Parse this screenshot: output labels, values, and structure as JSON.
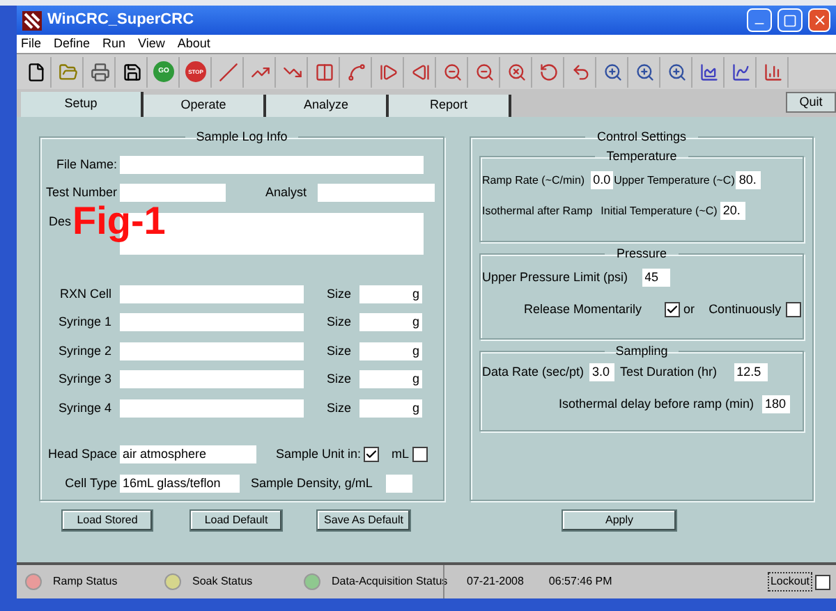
{
  "window": {
    "title": "WinCRC_SuperCRC"
  },
  "menu": [
    "File",
    "Define",
    "Run",
    "View",
    "About"
  ],
  "toolbar": {
    "go": "GO",
    "stop": "STOP"
  },
  "tabs": [
    {
      "label": "Setup",
      "selected": true
    },
    {
      "label": "Operate",
      "selected": false
    },
    {
      "label": "Analyze",
      "selected": false
    },
    {
      "label": "Report",
      "selected": false
    }
  ],
  "quit": "Quit",
  "overlay": "Fig-1",
  "sample_log": {
    "title": "Sample Log Info",
    "file_name": {
      "label": "File Name:"
    },
    "test_number": {
      "label": "Test Number"
    },
    "analyst": {
      "label": "Analyst"
    },
    "description": {
      "label": "Des"
    },
    "components": [
      {
        "label": "RXN Cell",
        "size_label": "Size",
        "unit": "g"
      },
      {
        "label": "Syringe 1",
        "size_label": "Size",
        "unit": "g"
      },
      {
        "label": "Syringe 2",
        "size_label": "Size",
        "unit": "g"
      },
      {
        "label": "Syringe 3",
        "size_label": "Size",
        "unit": "g"
      },
      {
        "label": "Syringe 4",
        "size_label": "Size",
        "unit": "g"
      }
    ],
    "head_space": {
      "label": "Head Space",
      "value": "air atmosphere"
    },
    "sample_unit": {
      "label": "Sample Unit in:",
      "checked": true
    },
    "ml": {
      "label": "mL",
      "checked": false
    },
    "cell_type": {
      "label": "Cell Type",
      "value": "16mL glass/teflon"
    },
    "density": {
      "label": "Sample Density, g/mL"
    }
  },
  "control": {
    "title": "Control Settings",
    "temperature": {
      "title": "Temperature",
      "ramp_rate": {
        "label": "Ramp Rate (~C/min)",
        "value": "0.0"
      },
      "upper": {
        "label": "Upper Temperature (~C)",
        "value": "80."
      },
      "isothermal": "Isothermal after Ramp",
      "initial": {
        "label": "Initial Temperature (~C)",
        "value": "20."
      }
    },
    "pressure": {
      "title": "Pressure",
      "limit": {
        "label": "Upper Pressure Limit (psi)",
        "value": "45"
      },
      "momentarily": {
        "label": "Release Momentarily",
        "checked": true
      },
      "or": "or",
      "continuously": {
        "label": "Continuously",
        "checked": false
      }
    },
    "sampling": {
      "title": "Sampling",
      "data_rate": {
        "label": "Data Rate (sec/pt)",
        "value": "3.0"
      },
      "duration": {
        "label": "Test Duration (hr)",
        "value": "12.5"
      },
      "delay": {
        "label": "Isothermal delay before ramp (min)",
        "value": "180"
      }
    }
  },
  "buttons": [
    "Load Stored",
    "Load Default",
    "Save As Default"
  ],
  "apply": "Apply",
  "status_bar": {
    "lights": [
      {
        "label": "Ramp Status",
        "color": "#e89a9a"
      },
      {
        "label": "Soak Status",
        "color": "#d6d68c"
      },
      {
        "label": "Data-Acquisition Status",
        "color": "#8fc88f"
      }
    ],
    "date": "07-21-2008",
    "time": "06:57:46 PM",
    "lockout": {
      "label": "Lockout",
      "checked": false
    }
  }
}
